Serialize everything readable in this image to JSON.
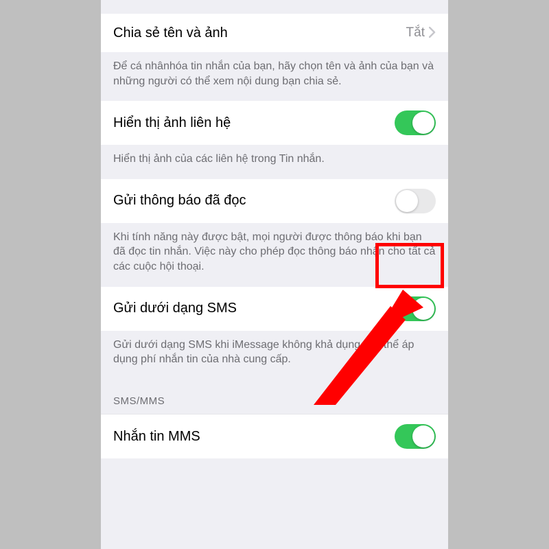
{
  "rows": {
    "share": {
      "label": "Chia sẻ tên và ảnh",
      "value": "Tắt",
      "footer": "Để cá nhânhóa tin nhắn của bạn, hãy chọn tên và ảnh của bạn và những người có thể xem nội dung bạn chia sẻ."
    },
    "contactPhotos": {
      "label": "Hiển thị ảnh liên hệ",
      "on": true,
      "footer": "Hiển thị ảnh của các liên hệ trong Tin nhắn."
    },
    "readReceipts": {
      "label": "Gửi thông báo đã đọc",
      "on": false,
      "footer": "Khi tính năng này được bật, mọi người được thông báo khi bạn đã đọc tin nhắn. Việc này cho phép đọc thông báo nhận cho tất cả các cuộc hội thoại."
    },
    "sendAsSms": {
      "label": "Gửi dưới dạng SMS",
      "on": true,
      "footer": "Gửi dưới dạng SMS khi iMessage không khả dụng. Có thể áp dụng phí nhắn tin của nhà cung cấp."
    },
    "smsHeader": "SMS/MMS",
    "mms": {
      "label": "Nhắn tin MMS",
      "on": true
    }
  },
  "colors": {
    "toggleOn": "#34c759",
    "annotation": "#ff0000"
  }
}
